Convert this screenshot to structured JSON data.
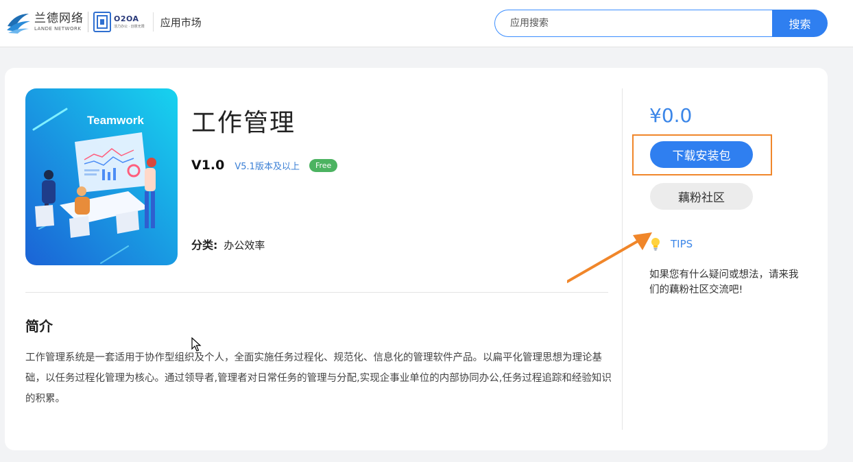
{
  "header": {
    "brand_cn": "兰德网络",
    "brand_en": "LANDE NETWORK",
    "o2oa_name": "O2OA",
    "o2oa_slogan": "活力办公 · 创意无限",
    "market_title": "应用市场",
    "search_placeholder": "应用搜索",
    "search_button": "搜索"
  },
  "app": {
    "icon_caption": "Teamwork",
    "title": "工作管理",
    "version": "V1.0",
    "compatibility": "V5.1版本及以上",
    "badge": "Free",
    "category_label": "分类:",
    "category_value": "办公效率"
  },
  "intro": {
    "title": "简介",
    "text": "工作管理系统是一套适用于协作型组织及个人，全面实施任务过程化、规范化、信息化的管理软件产品。以扁平化管理思想为理论基础，以任务过程化管理为核心。通过领导者,管理者对日常任务的管理与分配,实现企事业单位的内部协同办公,任务过程追踪和经验知识的积累。"
  },
  "sidebar": {
    "price": "¥0.0",
    "download_button": "下载安装包",
    "community_button": "藕粉社区",
    "tips_label": "TIPS",
    "tips_text": "如果您有什么疑问或想法，请来我们的藕粉社区交流吧!"
  },
  "colors": {
    "accent": "#2f7ff0",
    "price": "#3b86e8",
    "badge": "#4cb361",
    "highlight": "#f0862a"
  },
  "icons": {
    "brand": "lande-logo-icon",
    "o2oa": "o2oa-logo-icon",
    "tips": "lightbulb-icon",
    "arrow": "annotation-arrow-icon",
    "cursor": "mouse-cursor-icon"
  }
}
